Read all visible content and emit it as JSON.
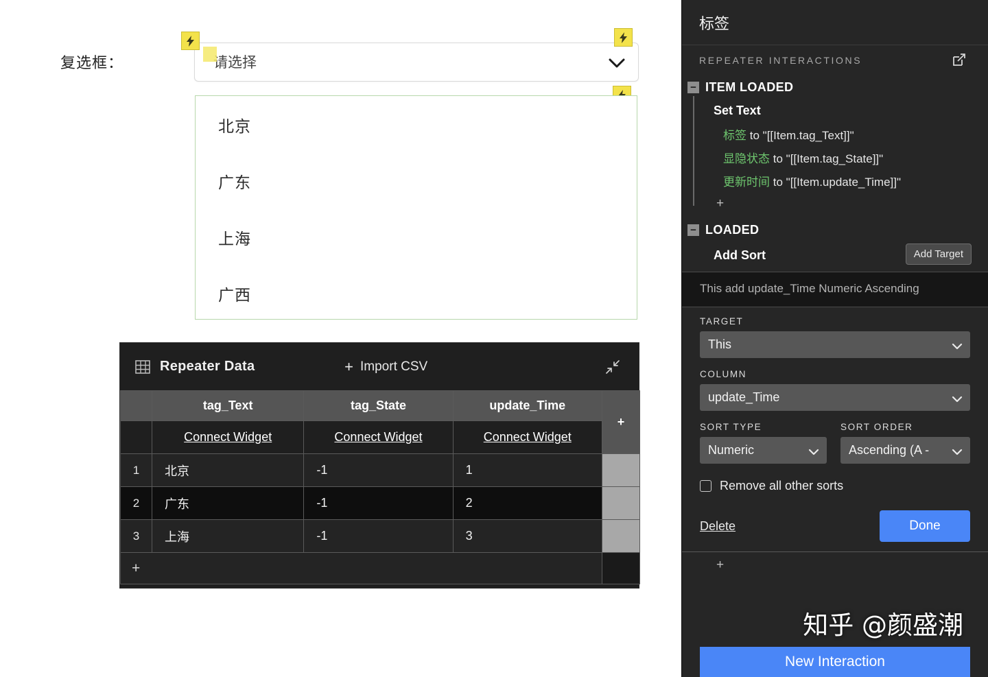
{
  "canvas": {
    "field_label": "复选框：",
    "select": {
      "placeholder": "请选择",
      "caret_icon": "chevron-down-icon"
    },
    "bolt_icon": "lightning-bolt-icon",
    "dropdown_items": [
      "北京",
      "广东",
      "上海",
      "广西"
    ]
  },
  "repeater_data": {
    "title": "Repeater Data",
    "grid_icon": "table-grid-icon",
    "import_label": "Import CSV",
    "import_plus": "+",
    "collapse_icon": "collapse-arrows-icon",
    "add_column_plus": "+",
    "add_row_plus": "+",
    "columns": [
      "tag_Text",
      "tag_State",
      "update_Time"
    ],
    "connect_widget_label": "Connect Widget",
    "rows": [
      {
        "index": "1",
        "tag_Text": "北京",
        "tag_State": "-1",
        "update_Time": "1"
      },
      {
        "index": "2",
        "tag_Text": "广东",
        "tag_State": "-1",
        "update_Time": "2"
      },
      {
        "index": "3",
        "tag_Text": "上海",
        "tag_State": "-1",
        "update_Time": "3"
      }
    ]
  },
  "panel": {
    "title": "标签",
    "section_label": "REPEATER INTERACTIONS",
    "external_icon": "open-external-icon",
    "events": [
      {
        "name": "ITEM LOADED",
        "toggle": "−"
      },
      {
        "name": "LOADED",
        "toggle": "−"
      }
    ],
    "item_loaded": {
      "action_name": "Set Text",
      "set_lines": [
        {
          "target": "标签",
          "to": "to",
          "value": "\"[[Item.tag_Text]]\""
        },
        {
          "target": "显隐状态",
          "to": "to",
          "value": "\"[[Item.tag_State]]\""
        },
        {
          "target": "更新时间",
          "to": "to",
          "value": "\"[[Item.update_Time]]\""
        }
      ],
      "plus": "+"
    },
    "loaded": {
      "action_name": "Add Sort",
      "add_target_label": "Add Target",
      "summary": "This add update_Time Numeric Ascending",
      "fields": {
        "target_label": "TARGET",
        "target_value": "This",
        "column_label": "COLUMN",
        "column_value": "update_Time",
        "sort_type_label": "SORT TYPE",
        "sort_type_value": "Numeric",
        "sort_order_label": "SORT ORDER",
        "sort_order_value": "Ascending (A -",
        "chevron_icon": "chevron-down-icon"
      },
      "remove_all_label": "Remove all other sorts",
      "delete_label": "Delete",
      "done_label": "Done",
      "plus": "+"
    },
    "new_interaction_label": "New Interaction"
  },
  "watermark": "知乎 @颜盛潮",
  "colors": {
    "accent_blue": "#4a86f7",
    "bolt_yellow": "#f3e24b",
    "green_text": "#6ec66e",
    "panel_bg": "#262626",
    "table_bg": "#1f1f1f",
    "dropdown_border": "#b7d7ab"
  }
}
